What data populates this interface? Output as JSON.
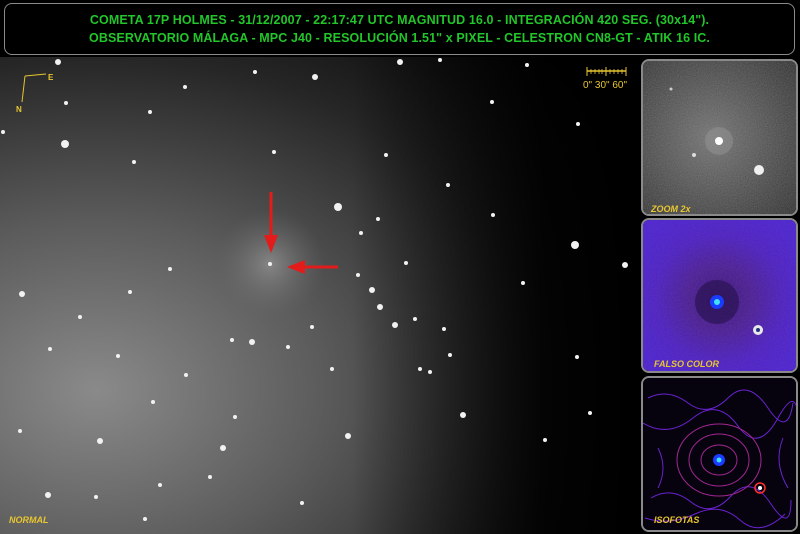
{
  "header": {
    "line1": "COMETA 17P  HOLMES - 31/12/2007 - 22:17:47 UTC MAGNITUD 16.0 - INTEGRACIÓN 420 SEG. (30x14\").",
    "line2": "OBSERVATORIO MÁLAGA  - MPC J40 - RESOLUCIÓN 1.51\" x PIXEL - CELESTRON CN8-GT - ATIK 16 IC."
  },
  "main": {
    "label": "NORMAL",
    "compass": {
      "east": "E",
      "north": "N"
    },
    "scale": "0\"  30\"  60\""
  },
  "panels": {
    "zoom": "ZOOM 2x",
    "falso": "FALSO COLOR",
    "iso": "ISOFOTAS"
  },
  "colors": {
    "header_text": "#22c52a",
    "label_text": "#e8c630",
    "arrow": "#e31b1b",
    "frame": "#8a8a8a"
  }
}
